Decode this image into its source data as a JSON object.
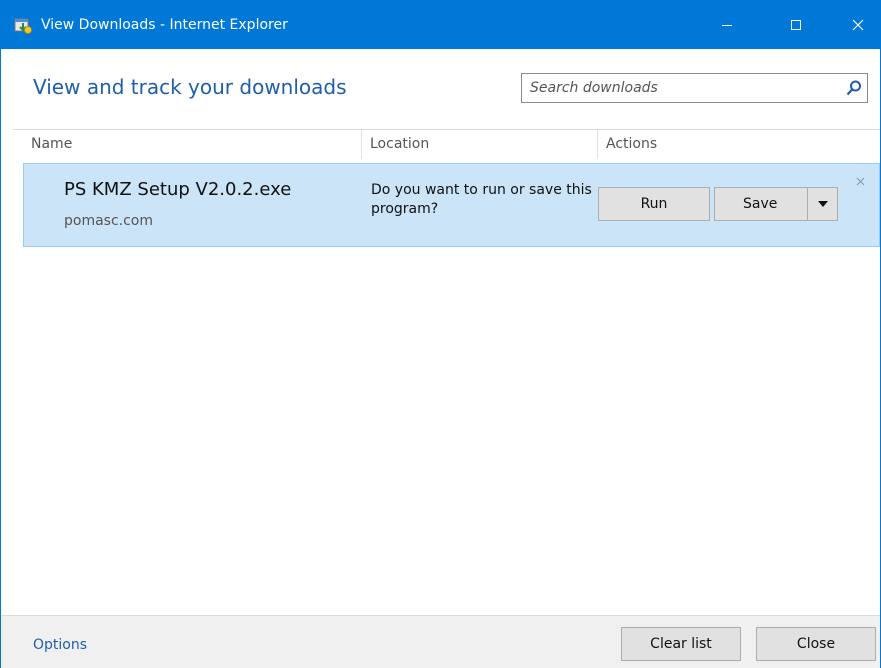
{
  "window": {
    "title": "View Downloads - Internet Explorer",
    "accent_color": "#0078d7",
    "controls": {
      "minimize_icon": "minimize-icon",
      "maximize_icon": "maximize-icon",
      "close_icon": "close-icon"
    }
  },
  "header": {
    "heading": "View and track your downloads",
    "search": {
      "placeholder": "Search downloads",
      "value": "",
      "icon": "search-icon"
    }
  },
  "columns": {
    "name": "Name",
    "location": "Location",
    "actions": "Actions"
  },
  "downloads": [
    {
      "file_name": "PS KMZ Setup V2.0.2.exe",
      "source": "pomasc.com",
      "location_text": "Do you want to run or save this program?",
      "run_label": "Run",
      "save_label": "Save",
      "selected_row_color": "#cce4f7"
    }
  ],
  "footer": {
    "options_label": "Options",
    "clear_list_label": "Clear list",
    "close_label": "Close"
  }
}
